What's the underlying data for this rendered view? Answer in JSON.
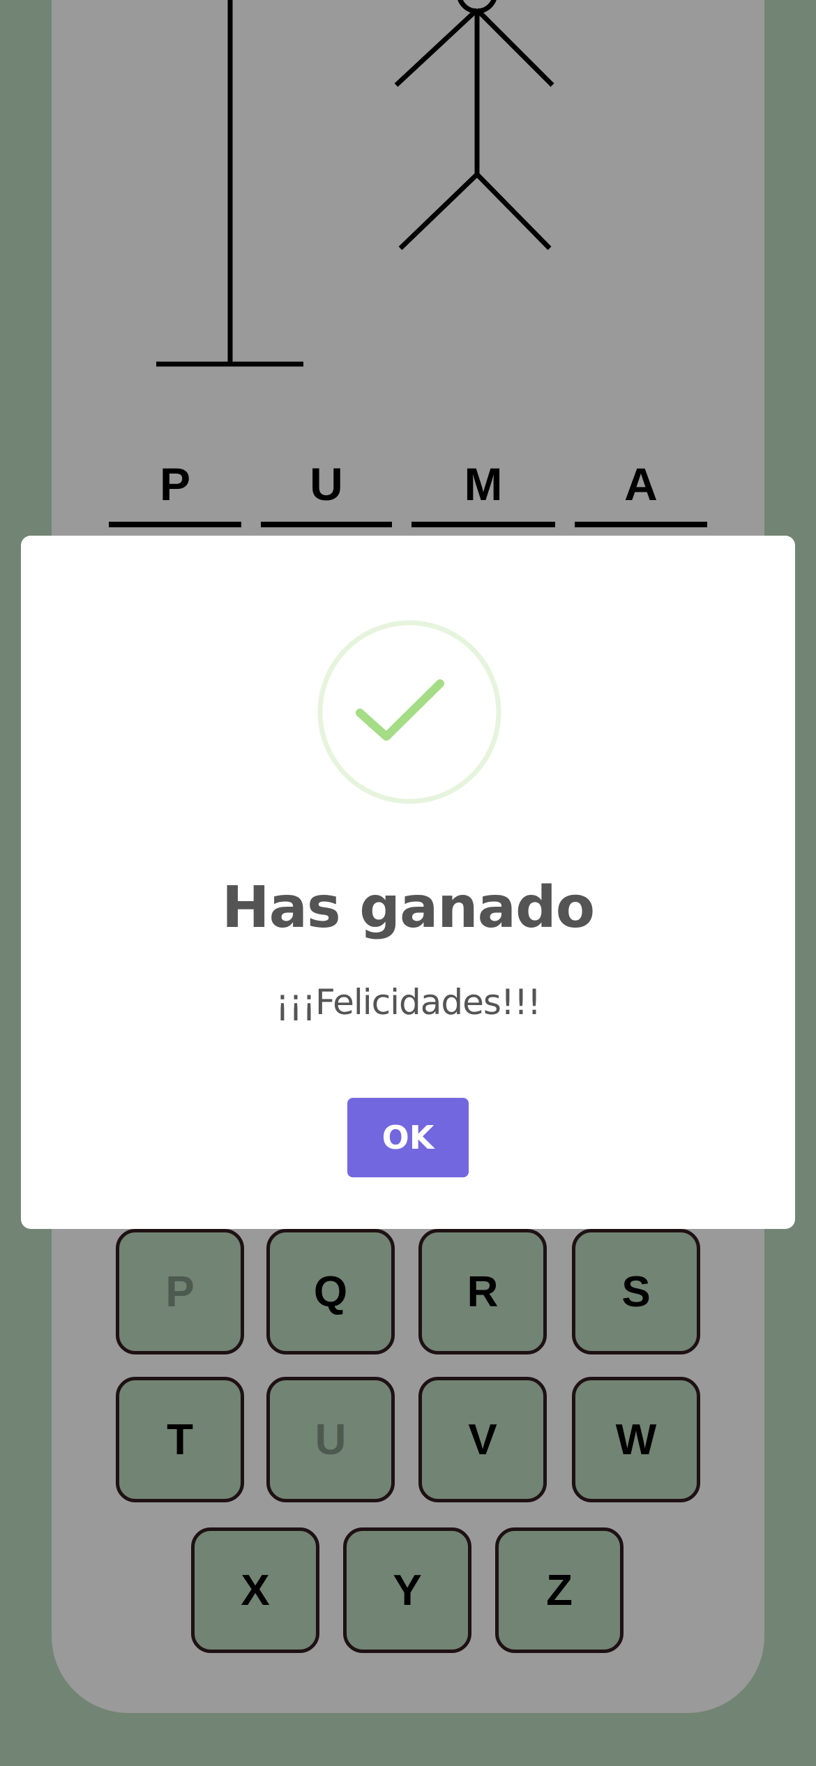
{
  "word": {
    "letters": [
      "P",
      "U",
      "M",
      "A"
    ]
  },
  "keyboard": {
    "keys": [
      {
        "label": "P",
        "used": true
      },
      {
        "label": "Q",
        "used": false
      },
      {
        "label": "R",
        "used": false
      },
      {
        "label": "S",
        "used": false
      },
      {
        "label": "T",
        "used": false
      },
      {
        "label": "U",
        "used": true
      },
      {
        "label": "V",
        "used": false
      },
      {
        "label": "W",
        "used": false
      },
      {
        "label": "X",
        "used": false
      },
      {
        "label": "Y",
        "used": false
      },
      {
        "label": "Z",
        "used": false
      }
    ]
  },
  "dialog": {
    "icon": "checkmark-success-icon",
    "title": "Has ganado",
    "message": "¡¡¡Felicidades!!!",
    "ok_label": "OK"
  },
  "colors": {
    "background": "#728473",
    "panel": "#9a9a9a",
    "key_fill": "#728473",
    "used_key_text": "#4d5a4f",
    "success": "#a5dc86",
    "button": "#7367e0"
  }
}
